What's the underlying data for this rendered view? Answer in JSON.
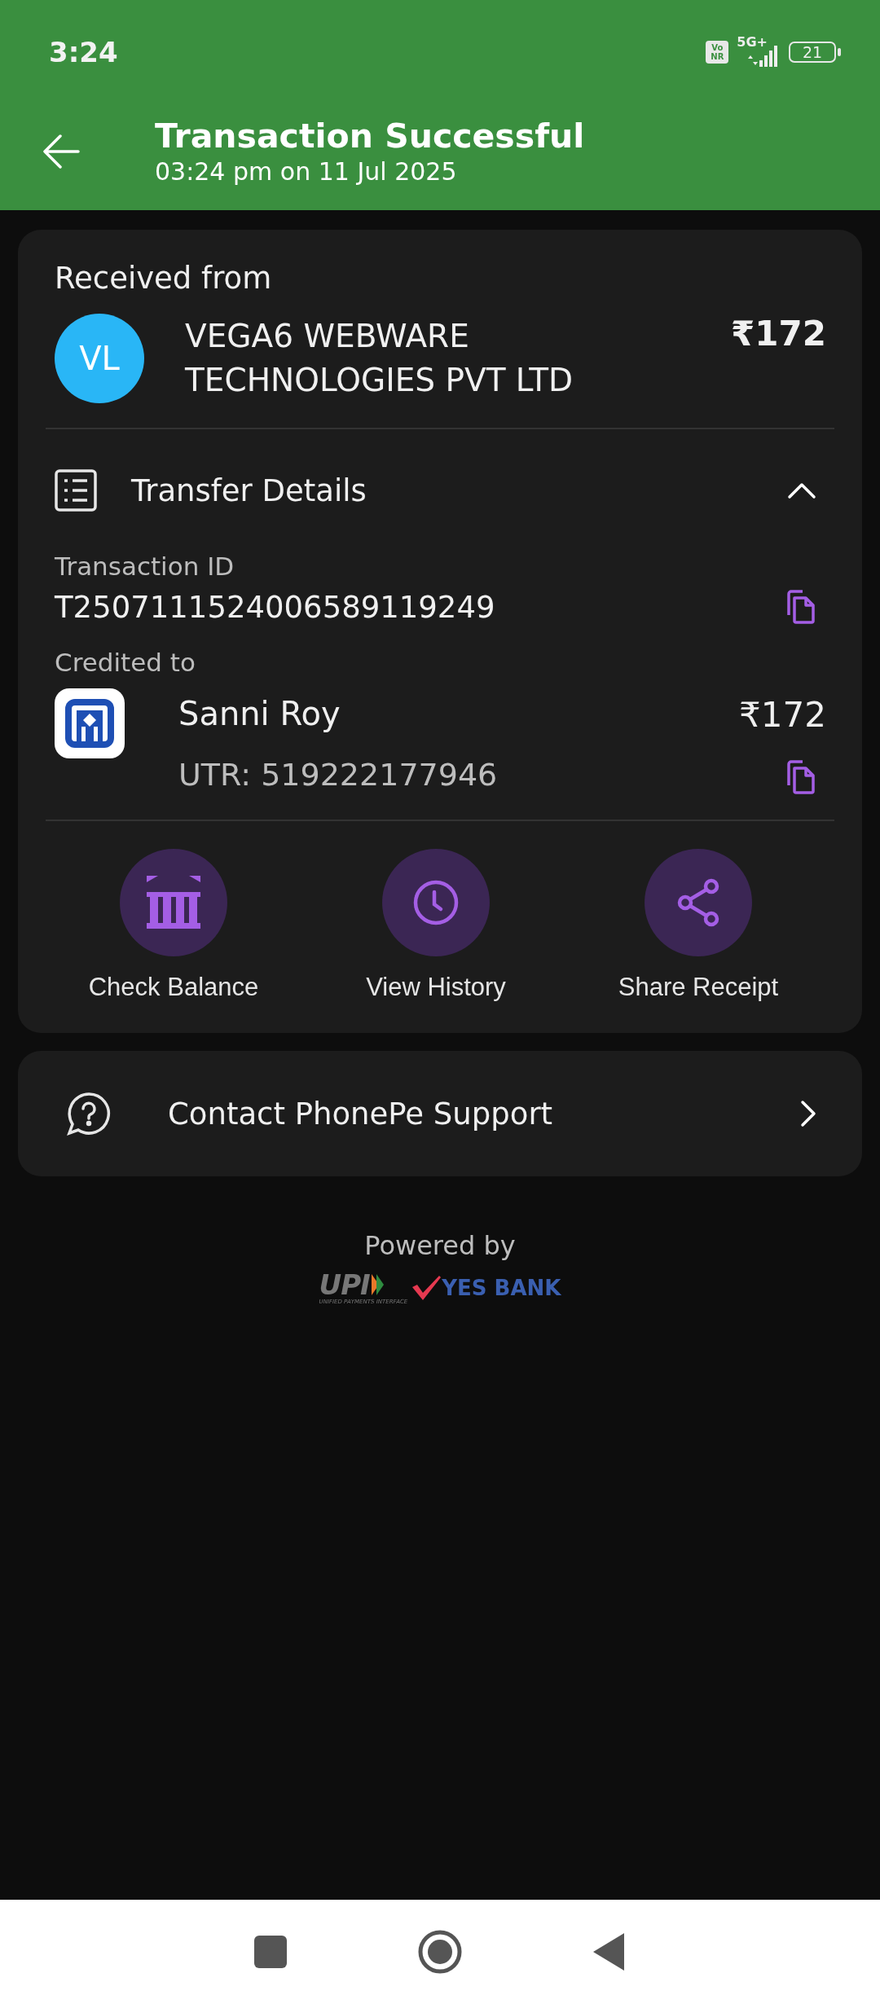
{
  "status_bar": {
    "time": "3:24",
    "network_badge_top": "Vo",
    "network_badge_bottom": "NR",
    "network_type": "5G+",
    "battery": "21"
  },
  "header": {
    "title": "Transaction Successful",
    "subtitle": "03:24 pm on 11 Jul 2025"
  },
  "received": {
    "label": "Received from",
    "avatar": "VL",
    "name": "VEGA6 WEBWARE TECHNOLOGIES PVT LTD",
    "amount": "₹172"
  },
  "transfer_details": {
    "title": "Transfer Details",
    "expanded": true,
    "transaction_id_label": "Transaction ID",
    "transaction_id": "T2507111524006589119249",
    "credited_label": "Credited to",
    "recipient": "Sanni Roy",
    "amount": "₹172",
    "utr": "UTR: 519222177946"
  },
  "actions": [
    {
      "kind": "bank",
      "label": "Check Balance"
    },
    {
      "kind": "history",
      "label": "View History"
    },
    {
      "kind": "share",
      "label": "Share Receipt"
    }
  ],
  "support": {
    "label": "Contact PhonePe Support"
  },
  "footer": {
    "powered_by": "Powered by",
    "upi": "UPI",
    "upi_caption": "UNIFIED PAYMENTS INTERFACE",
    "bank": "YES BANK"
  }
}
